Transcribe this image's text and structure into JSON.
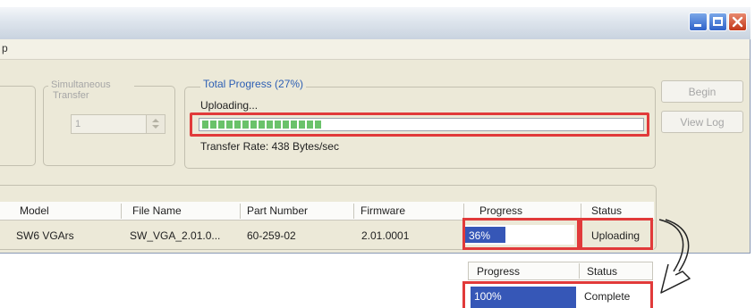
{
  "window": {
    "menu_fragment": "p",
    "controls": {
      "minimize_icon": "minimize-icon",
      "maximize_icon": "maximize-icon",
      "close_icon": "close-icon"
    }
  },
  "simultaneous": {
    "legend": "Simultaneous Transfer",
    "legend_line1": "Simultaneous",
    "legend_line2": "Transfer",
    "value": "1"
  },
  "total_progress": {
    "legend": "Total Progress (27%)",
    "status": "Uploading...",
    "percent": 27,
    "rate": "Transfer Rate: 438 Bytes/sec"
  },
  "buttons": {
    "begin": "Begin",
    "view_log": "View Log"
  },
  "table": {
    "columns": [
      "Model",
      "File Name",
      "Part Number",
      "Firmware",
      "Progress",
      "Status"
    ],
    "rows": [
      {
        "model": "SW6 VGArs",
        "file_name": "SW_VGA_2.01.0...",
        "part_number": "60-259-02",
        "firmware": "2.01.0001",
        "progress": "36%",
        "progress_value": 36,
        "status": "Uploading"
      }
    ]
  },
  "callout": {
    "columns": [
      "Progress",
      "Status"
    ],
    "progress": "100%",
    "progress_value": 100,
    "status": "Complete"
  },
  "colors": {
    "highlight": "#e13a3a",
    "progress_green": "#6ac26a",
    "selection_blue": "#3657b7",
    "legend_blue": "#2d5fb4"
  }
}
